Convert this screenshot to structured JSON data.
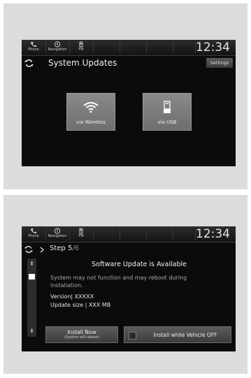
{
  "screen1": {
    "statusbar": {
      "items": [
        {
          "label": "Phone",
          "icon": "phone-icon"
        },
        {
          "label": "Navigation",
          "icon": "navigation-icon"
        },
        {
          "label": "FM",
          "icon": "radio-icon"
        }
      ],
      "clock": "12:34"
    },
    "title": "System Updates",
    "settings_label": "Settings",
    "tiles": [
      {
        "label": "via Wireless",
        "icon": "wifi-icon"
      },
      {
        "label": "via USB",
        "icon": "usb-icon"
      }
    ]
  },
  "screen2": {
    "statusbar": {
      "items": [
        {
          "label": "Phone",
          "icon": "phone-icon"
        },
        {
          "label": "Navigation",
          "icon": "navigation-icon"
        },
        {
          "label": "FM",
          "icon": "radio-icon"
        }
      ],
      "clock": "12:34"
    },
    "step_label": "Step 5",
    "step_total": "/6",
    "heading": "Software Update is Available",
    "warning": "System may not function and may reboot during installation.",
    "version_label": "Version",
    "version_value": "XXXXX",
    "size_label": "Update size",
    "size_value": "XXX MB",
    "install_now_label": "Install Now",
    "install_now_sub": "(System will reboot)",
    "install_off_label": "Install while Vehicle OFF"
  },
  "colors": {
    "panel_bg": "#dcdcdc",
    "screen_bg": "#0b0b0b",
    "tile_bg": "#7c7c7c"
  }
}
